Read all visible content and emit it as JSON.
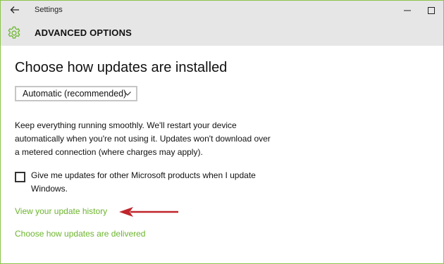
{
  "window": {
    "app_title": "Settings"
  },
  "header": {
    "title": "ADVANCED OPTIONS"
  },
  "main": {
    "heading": "Choose how updates are installed",
    "install_mode": {
      "selected": "Automatic (recommended)"
    },
    "description": "Keep everything running smoothly. We'll restart your device automatically when you're not using it. Updates won't download over a metered connection (where charges may apply).",
    "microsoft_updates_option": {
      "label": "Give me updates for other Microsoft products when I update Windows.",
      "checked": false
    },
    "links": {
      "update_history": "View your update history",
      "delivery": "Choose how updates are delivered"
    }
  },
  "icons": {
    "back": "back-arrow-icon",
    "settings": "gear-icon",
    "minimize": "minimize-icon",
    "maximize": "maximize-icon",
    "dropdown": "chevron-down-icon",
    "annotation": "red-arrow-icon"
  },
  "colors": {
    "accent": "#6cb52d",
    "window_border": "#8bc34a",
    "annotation_arrow": "#c0252b",
    "chrome_background": "#e6e6e6"
  }
}
